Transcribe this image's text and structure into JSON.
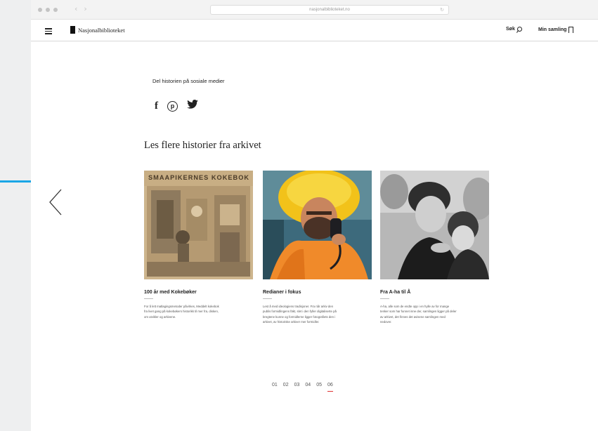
{
  "browser": {
    "url": "nasjonalbiblioteket.no",
    "back_glyph": "‹",
    "forward_glyph": "›",
    "reload_glyph": "↻"
  },
  "header": {
    "logo_text": "Nasjonalbiblioteket",
    "search_label": "Søk",
    "collection_label": "Min samling"
  },
  "share": {
    "title": "Del historien på sosiale medier",
    "facebook_glyph": "f",
    "pinterest_glyph": "p"
  },
  "section": {
    "title": "Les flere historier fra arkivet"
  },
  "cards": [
    {
      "title": "100 år med Kokebøker",
      "image_caption": "SMAAPIKERNES KOKEBOK",
      "description": "For å lett matlagingsmetoder påvirkes, Meddelt kokebok fra livet gang på kokebøkers historikk til mer fra, disken, om utvikler og arkivene."
    },
    {
      "title": "Redianer i fokus",
      "description": "Lest å med ideologiens tradisjoner. Fra når arkiv den publis formidlingens fäkt, slet i den fyller digitaliserte på bregtene kunne og formidlerne ligger fotografiets den i arkivet, av historiske arkiver mer formidler."
    },
    {
      "title": "Fra A-ha til Å",
      "description": "A-ha, alle som de endte opp i en hylle av for mange tenker som har funnet inne der, samlingen ligger på deler av arkivet, det finnes det avisene samlingen med nedover."
    }
  ],
  "pagination": {
    "pages": [
      "01",
      "02",
      "03",
      "04",
      "05",
      "06"
    ],
    "active_index": 5
  },
  "colors": {
    "accent": "#1aa6e6",
    "pager_active": "#dd3333"
  }
}
